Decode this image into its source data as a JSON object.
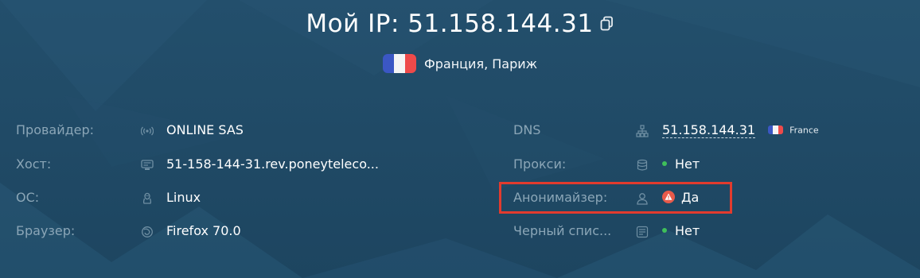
{
  "header": {
    "ip_title": "Мой IP: 51.158.144.31",
    "location": "Франция, Париж"
  },
  "left_info": [
    {
      "label": "Провайдер:",
      "icon": "signal-icon",
      "value": "ONLINE SAS"
    },
    {
      "label": "Хост:",
      "icon": "server-icon",
      "value": "51-158-144-31.rev.poneyteleco..."
    },
    {
      "label": "ОС:",
      "icon": "linux-icon",
      "value": "Linux"
    },
    {
      "label": "Браузер:",
      "icon": "browser-icon",
      "value": "Firefox 70.0"
    }
  ],
  "right_info": {
    "dns": {
      "label": "DNS",
      "icon": "network-icon",
      "value": "51.158.144.31",
      "country": "France"
    },
    "proxy": {
      "label": "Прокси:",
      "icon": "database-icon",
      "value": "Нет"
    },
    "anonymizer": {
      "label": "Анонимайзер:",
      "icon": "user-icon",
      "value": "Да"
    },
    "blacklist": {
      "label": "Черный спис...",
      "icon": "list-icon",
      "value": "Нет"
    }
  },
  "colors": {
    "background": "#1f4a66",
    "label": "#8ba6b7",
    "status_ok": "#3fbf5a",
    "status_warn": "#e85a4a",
    "highlight": "#e23b2e"
  }
}
